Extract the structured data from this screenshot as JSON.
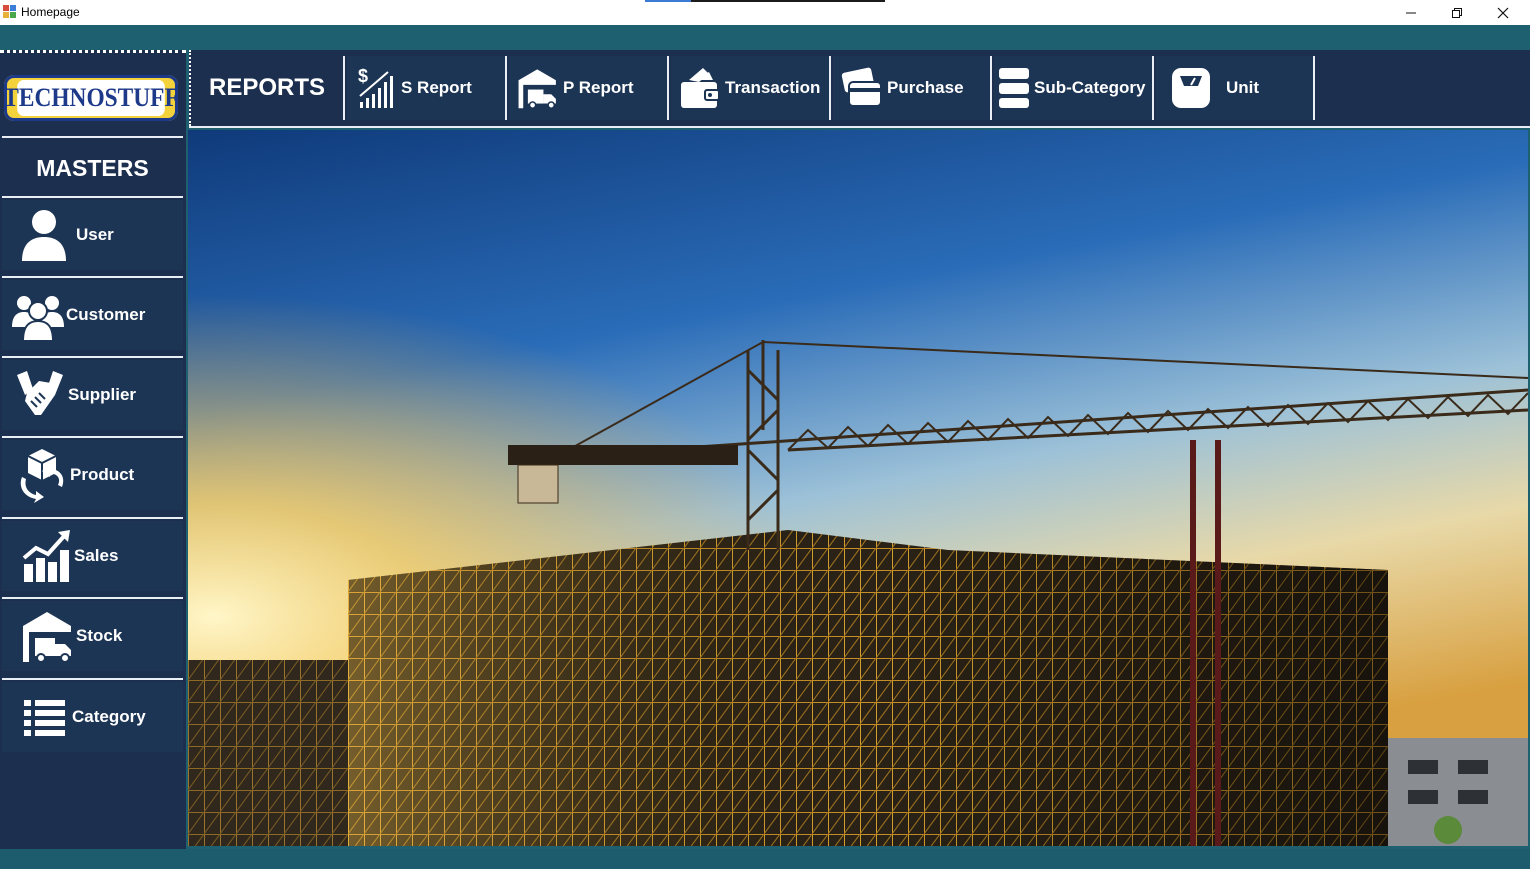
{
  "window": {
    "title": "Homepage"
  },
  "logo": {
    "text": "TECHNOSTUFF"
  },
  "sidebar": {
    "heading": "MASTERS",
    "items": [
      {
        "label": "User",
        "icon": "user-icon"
      },
      {
        "label": "Customer",
        "icon": "group-icon"
      },
      {
        "label": "Supplier",
        "icon": "handshake-icon"
      },
      {
        "label": "Product",
        "icon": "product-box-icon"
      },
      {
        "label": "Sales",
        "icon": "sales-chart-icon"
      },
      {
        "label": "Stock",
        "icon": "warehouse-truck-icon"
      },
      {
        "label": "Category",
        "icon": "list-icon"
      }
    ]
  },
  "topbar": {
    "heading": "REPORTS",
    "tabs": [
      {
        "label": "S Report",
        "icon": "dollar-bars-icon"
      },
      {
        "label": "P Report",
        "icon": "warehouse-truck-icon"
      },
      {
        "label": "Transaction",
        "icon": "wallet-icon"
      },
      {
        "label": "Purchase",
        "icon": "card-icon"
      },
      {
        "label": "Sub-Category",
        "icon": "database-icon"
      },
      {
        "label": "Unit",
        "icon": "scale-icon"
      }
    ]
  },
  "colors": {
    "frame": "#1f6070",
    "panel": "#1c2f4f",
    "button": "#1d3554",
    "logo_yellow": "#f4d23b",
    "logo_blue": "#1d3a8a"
  }
}
